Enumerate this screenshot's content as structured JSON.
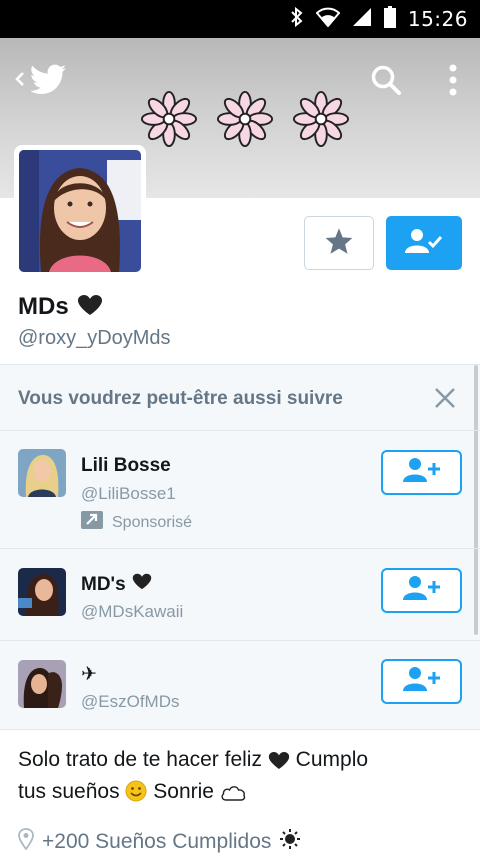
{
  "status_bar": {
    "time": "15:26",
    "icons": [
      "bluetooth-icon",
      "wifi-icon",
      "signal-icon",
      "battery-icon"
    ]
  },
  "header": {
    "icons": [
      "back-icon",
      "twitter-bird-icon",
      "search-icon",
      "more-vert-icon",
      "flower-icon"
    ]
  },
  "profile": {
    "name": "MDs",
    "name_emoji": "heart",
    "handle": "@roxy_yDoyMds",
    "buttons": [
      "star-icon",
      "following-icon"
    ]
  },
  "suggestions": {
    "title": "Vous voudrez peut-être aussi suivre",
    "accounts": [
      {
        "name": "Lili Bosse",
        "handle": "@LiliBosse1",
        "promoted": "Sponsorisé"
      },
      {
        "name": "MD's",
        "handle": "@MDsKawaii"
      },
      {
        "name": "✈",
        "handle": "@EszOfMDs"
      }
    ]
  },
  "bio": {
    "line1_a": "Solo trato de te hacer feliz",
    "line1_b": "Cumplo",
    "line2_a": "tus sueños",
    "line2_b": "Sonrie",
    "emojis": [
      "heart",
      "smiley",
      "cloud"
    ]
  },
  "location": {
    "text": "+200 Sueños Cumplidos"
  },
  "colors": {
    "accent": "#1da1f2",
    "text": "#14171a",
    "muted": "#657786",
    "panel": "#f5f8fa",
    "border": "#e1e8ed"
  }
}
